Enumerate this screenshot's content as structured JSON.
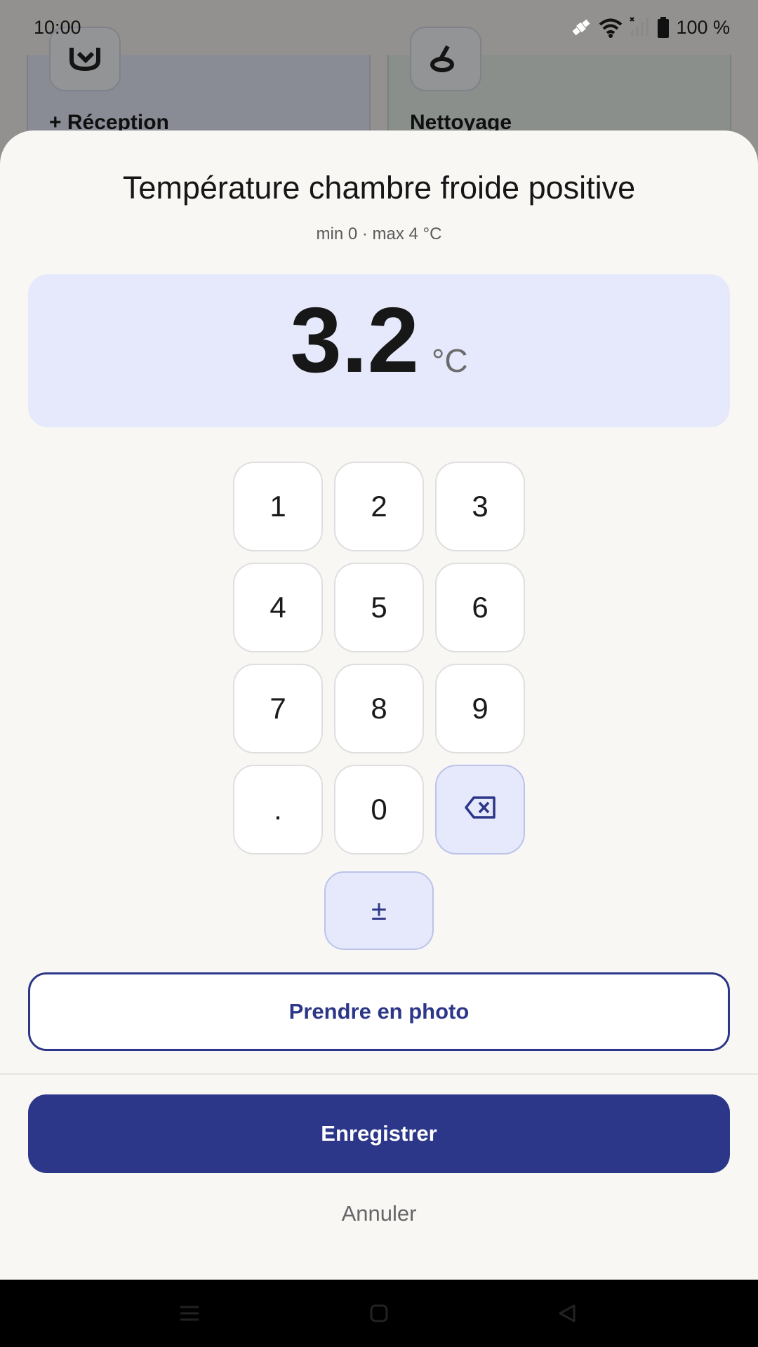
{
  "status_bar": {
    "time": "10:00",
    "battery_text": "100 %"
  },
  "background": {
    "card_left_label": "+ Réception",
    "card_right_label": "Nettoyage"
  },
  "sheet": {
    "title": "Température chambre froide positive",
    "subtitle": "min 0 · max 4 °C",
    "value": "3.2",
    "unit": "°C",
    "keys": [
      "1",
      "2",
      "3",
      "4",
      "5",
      "6",
      "7",
      "8",
      "9",
      ".",
      "0"
    ],
    "sign_key": "±",
    "photo_button": "Prendre en photo",
    "save_button": "Enregistrer",
    "cancel_button": "Annuler"
  },
  "colors": {
    "accent": "#2c378a",
    "display_background": "#e6e9fb",
    "sheet_background": "#f8f7f4"
  }
}
